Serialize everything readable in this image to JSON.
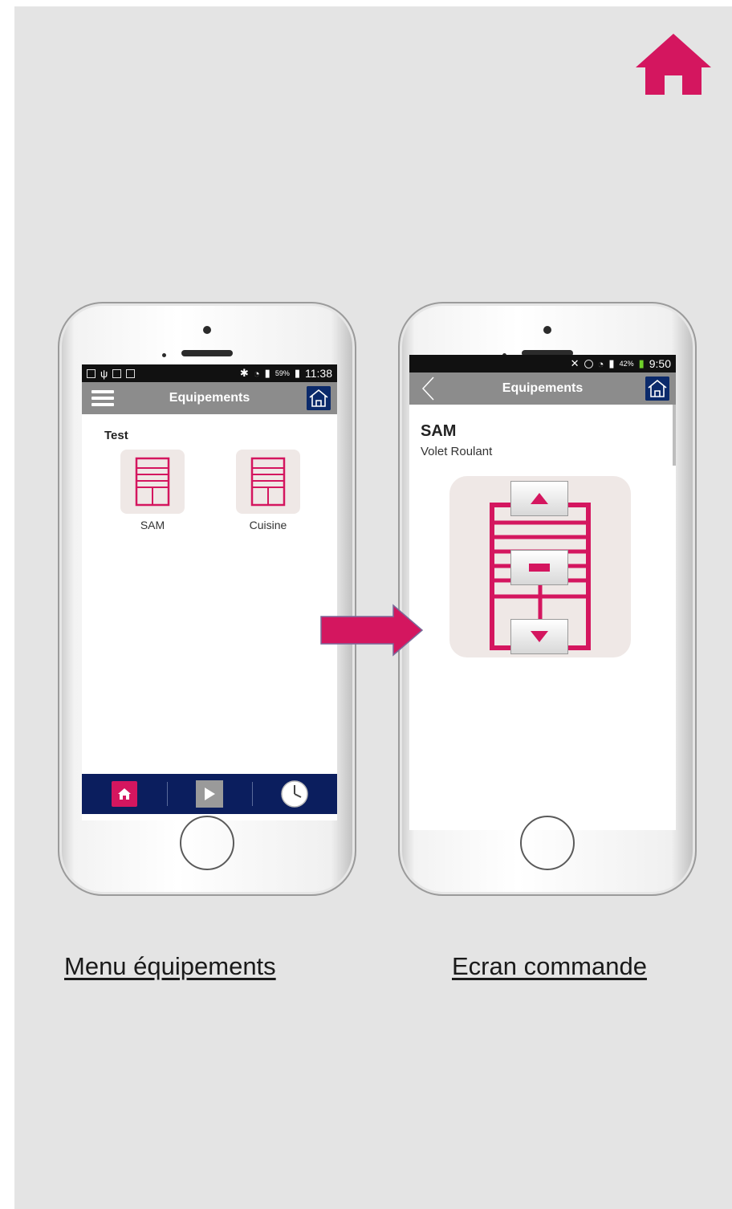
{
  "colors": {
    "accent": "#d4165f",
    "header_grey": "#8c8c8c",
    "navy": "#0b1e5e",
    "tile_bg": "#efe8e6",
    "slide_bg": "#e4e4e4"
  },
  "left_phone": {
    "status_time": "11:38",
    "status_battery": "59%",
    "header_title": "Equipements",
    "group_title": "Test",
    "tiles": [
      {
        "label": "SAM",
        "icon": "roller-shutter-icon"
      },
      {
        "label": "Cuisine",
        "icon": "roller-shutter-icon"
      }
    ],
    "bottom_nav": [
      "home-icon",
      "play-icon",
      "clock-icon"
    ]
  },
  "right_phone": {
    "status_time": "9:50",
    "status_battery": "42%",
    "header_title": "Equipements",
    "device_name": "SAM",
    "device_type": "Volet Roulant",
    "controls": [
      "up-arrow-icon",
      "stop-icon",
      "down-arrow-icon"
    ]
  },
  "captions": {
    "left": "Menu équipements",
    "right": "Ecran commande"
  }
}
